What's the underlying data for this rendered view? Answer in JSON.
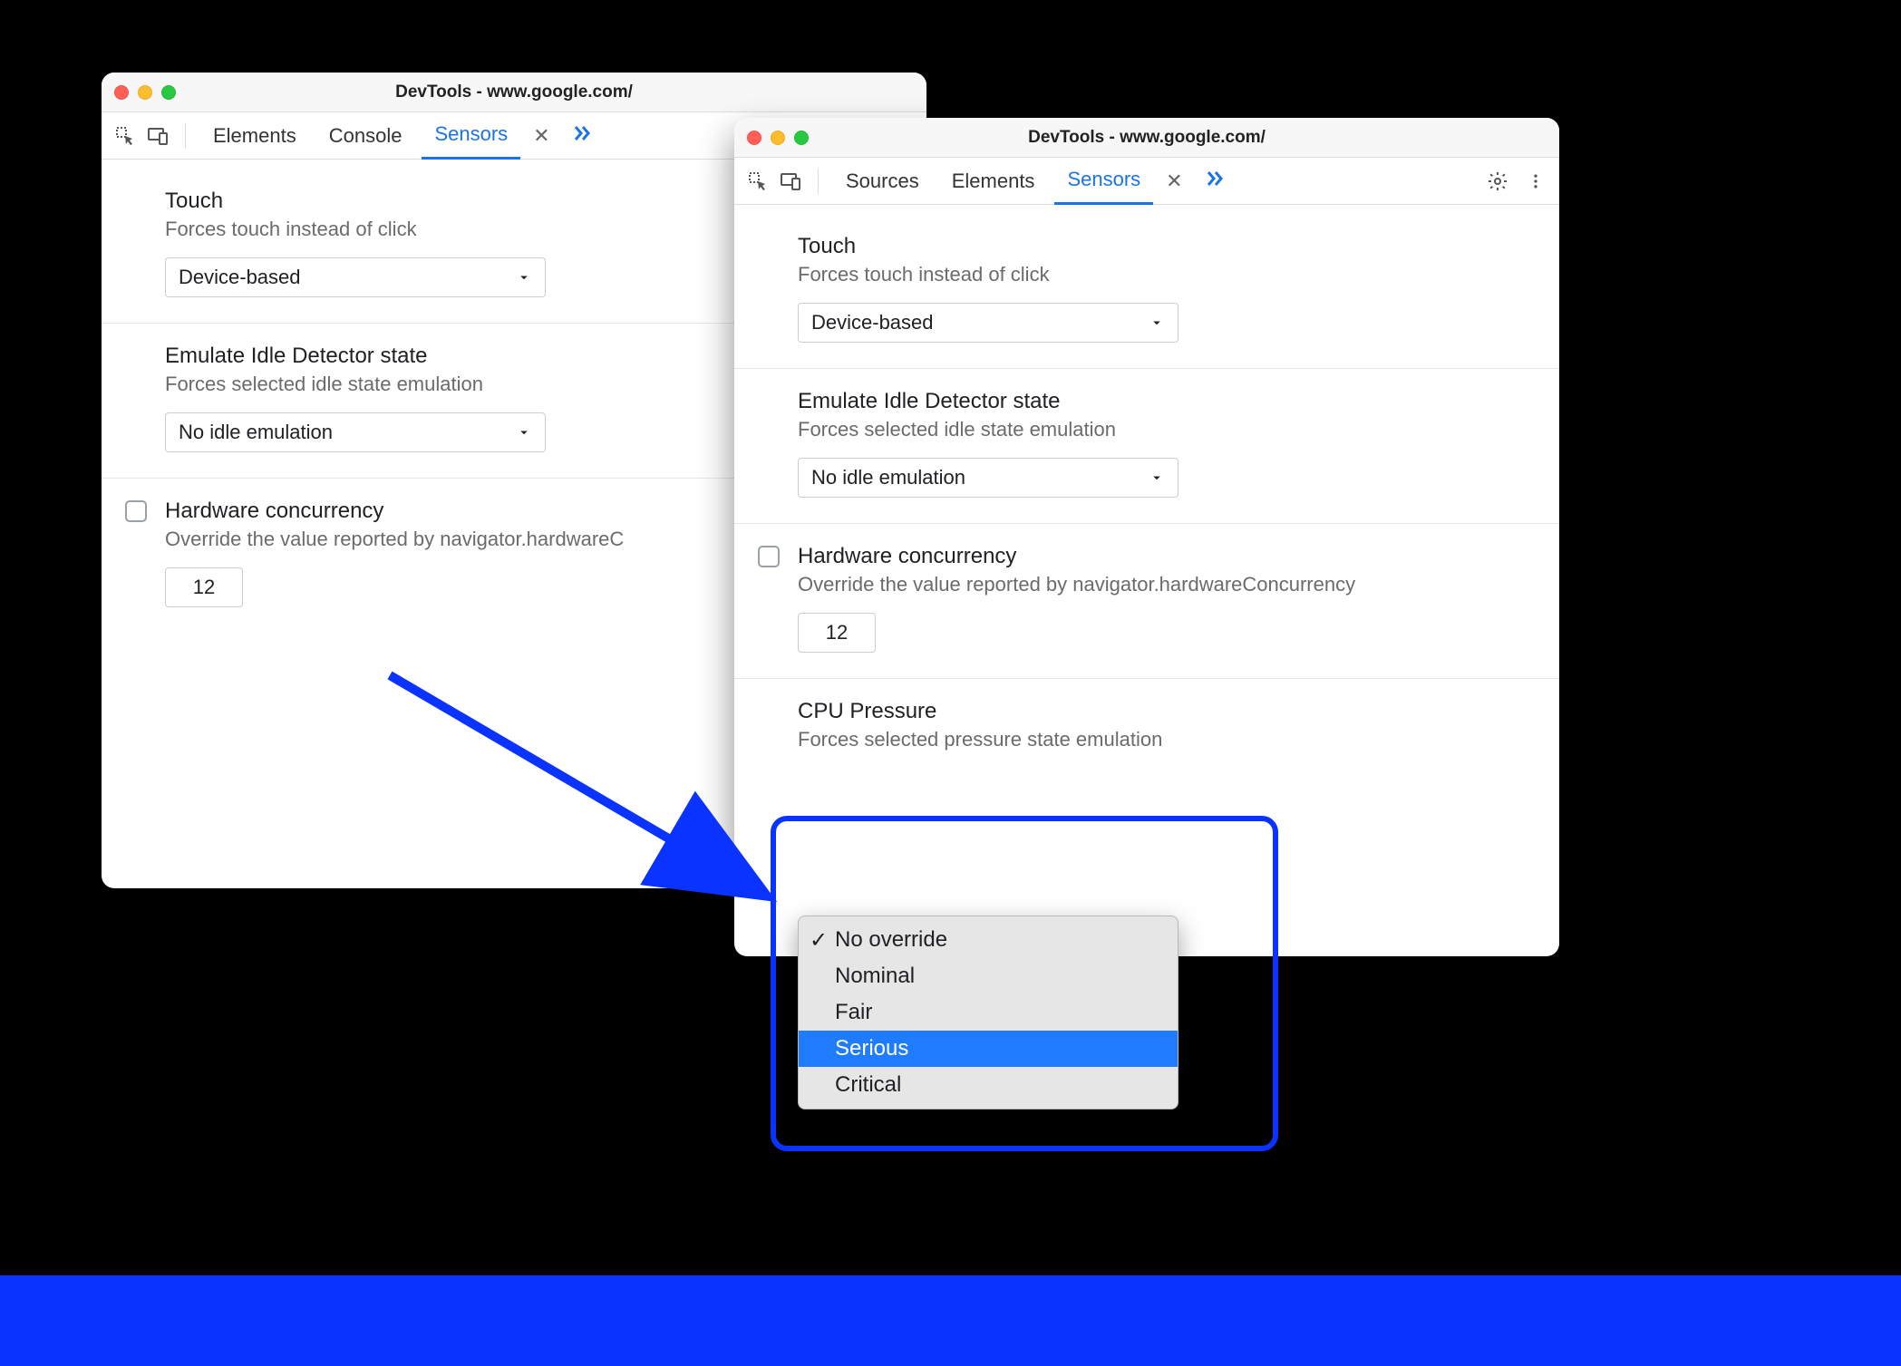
{
  "windowLeft": {
    "title": "DevTools - www.google.com/",
    "tabs": {
      "elements": "Elements",
      "console": "Console",
      "sensors": "Sensors"
    },
    "touch": {
      "title": "Touch",
      "subtitle": "Forces touch instead of click",
      "selected": "Device-based"
    },
    "idle": {
      "title": "Emulate Idle Detector state",
      "subtitle": "Forces selected idle state emulation",
      "selected": "No idle emulation"
    },
    "hc": {
      "title": "Hardware concurrency",
      "subtitle": "Override the value reported by navigator.hardwareC",
      "value": "12"
    }
  },
  "windowRight": {
    "title": "DevTools - www.google.com/",
    "tabs": {
      "sources": "Sources",
      "elements": "Elements",
      "sensors": "Sensors"
    },
    "touch": {
      "title": "Touch",
      "subtitle": "Forces touch instead of click",
      "selected": "Device-based"
    },
    "idle": {
      "title": "Emulate Idle Detector state",
      "subtitle": "Forces selected idle state emulation",
      "selected": "No idle emulation"
    },
    "hc": {
      "title": "Hardware concurrency",
      "subtitle": "Override the value reported by navigator.hardwareConcurrency",
      "value": "12"
    },
    "cpu": {
      "title": "CPU Pressure",
      "subtitle": "Forces selected pressure state emulation",
      "options": {
        "no_override": "No override",
        "nominal": "Nominal",
        "fair": "Fair",
        "serious": "Serious",
        "critical": "Critical"
      }
    }
  }
}
